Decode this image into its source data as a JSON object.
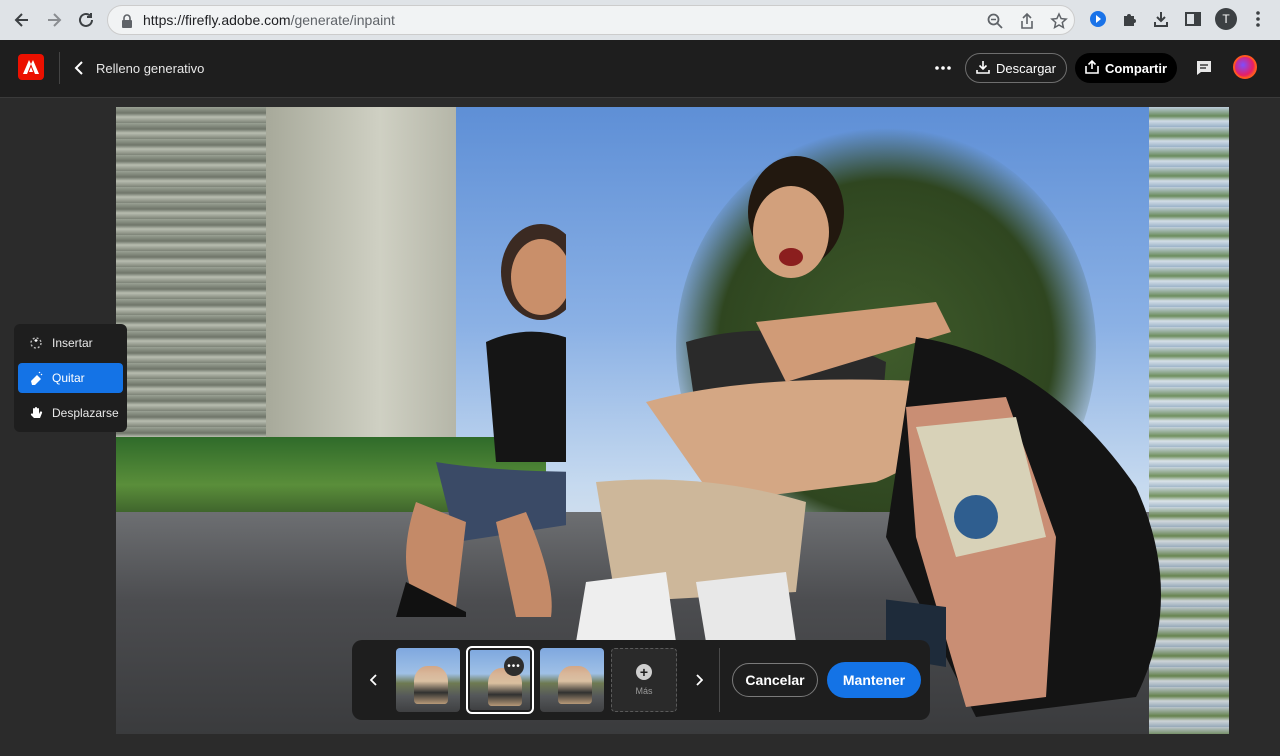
{
  "browser": {
    "url_host": "https://firefly.adobe.com",
    "url_path": "/generate/inpaint",
    "profile_initial": "T",
    "icons": [
      "back-arrow-icon",
      "forward-arrow-icon",
      "reload-icon",
      "lock-icon",
      "zoom-icon",
      "share-icon",
      "star-icon",
      "extension-blue-icon",
      "puzzle-icon",
      "download-icon",
      "sidepanel-icon",
      "kebab-menu-icon"
    ]
  },
  "header": {
    "title": "Relleno generativo",
    "download_label": "Descargar",
    "share_label": "Compartir"
  },
  "tools": [
    {
      "label": "Insertar",
      "icon": "insert-sparkle-icon",
      "active": false
    },
    {
      "label": "Quitar",
      "icon": "remove-eraser-icon",
      "active": true
    },
    {
      "label": "Desplazarse",
      "icon": "hand-pan-icon",
      "active": false
    }
  ],
  "bottombar": {
    "more_label": "Más",
    "cancel_label": "Cancelar",
    "keep_label": "Mantener",
    "selected_variation": 2,
    "variations": 3
  },
  "colors": {
    "accent": "#1473e6",
    "adobe_red": "#eb1000",
    "header_bg": "#1e1e1e",
    "workspace_bg": "#2b2b2b"
  }
}
